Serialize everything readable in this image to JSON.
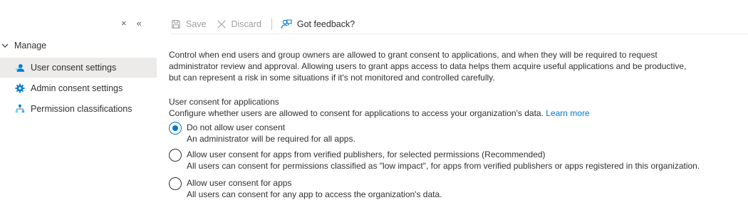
{
  "sidebar": {
    "close_glyph": "×",
    "collapse_glyph": "«",
    "group_label": "Manage",
    "items": [
      {
        "label": "User consent settings",
        "icon": "user-consent-icon",
        "active": true
      },
      {
        "label": "Admin consent settings",
        "icon": "admin-consent-gear-icon",
        "active": false
      },
      {
        "label": "Permission classifications",
        "icon": "permission-classifications-icon",
        "active": false
      }
    ]
  },
  "toolbar": {
    "save_label": "Save",
    "discard_label": "Discard",
    "feedback_label": "Got feedback?"
  },
  "main": {
    "description": "Control when end users and group owners are allowed to grant consent to applications, and when they will be required to request administrator review and approval. Allowing users to grant apps access to data helps them acquire useful applications and be productive, but can represent a risk in some situations if it's not monitored and controlled carefully.",
    "section_title": "User consent for applications",
    "section_desc": "Configure whether users are allowed to consent for applications to access your organization's data.",
    "learn_more": "Learn more",
    "options": [
      {
        "label": "Do not allow user consent",
        "sub": "An administrator will be required for all apps.",
        "selected": true
      },
      {
        "label": "Allow user consent for apps from verified publishers, for selected permissions (Recommended)",
        "sub": "All users can consent for permissions classified as \"low impact\", for apps from verified publishers or apps registered in this organization.",
        "selected": false
      },
      {
        "label": "Allow user consent for apps",
        "sub": "All users can consent for any app to access the organization's data.",
        "selected": false
      }
    ]
  },
  "colors": {
    "accent": "#0078d4",
    "active_nav_bg": "#edebe9",
    "disabled_text": "#a19f9d"
  }
}
